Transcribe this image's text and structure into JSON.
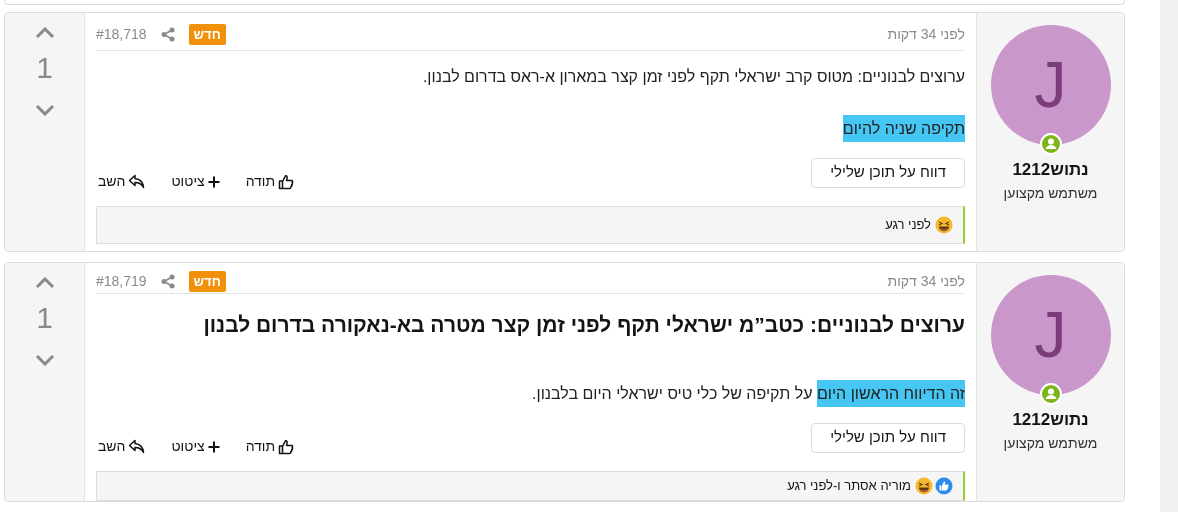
{
  "posts": [
    {
      "votes": "1",
      "time": "לפני 34 דקות",
      "badge": "חדש",
      "number": "#18,718",
      "author": {
        "name": "נתוש1212",
        "title": "משתמש מקצוען",
        "initial": "J",
        "online": true
      },
      "body": [
        {
          "kind": "text",
          "segments": [
            {
              "text": "ערוצים לבנוניים: מטוס קרב ישראלי תקף לפני זמן קצר במארון א-ראס בדרום לבנון.",
              "highlight": false
            }
          ]
        },
        {
          "kind": "text",
          "segments": [
            {
              "text": "תקיפה שניה להיום",
              "highlight": true
            }
          ]
        }
      ],
      "report": "דווח על תוכן שלילי",
      "actions": [
        {
          "kind": "thanks",
          "label": "תודה"
        },
        {
          "kind": "quote",
          "label": "ציטוט"
        },
        {
          "kind": "reply",
          "label": "השב"
        }
      ],
      "reactions": {
        "icons": [
          {
            "kind": "laugh"
          }
        ],
        "text": "לפני רגע"
      }
    },
    {
      "votes": "1",
      "time": "לפני 34 דקות",
      "badge": "חדש",
      "number": "#18,719",
      "author": {
        "name": "נתוש1212",
        "title": "משתמש מקצוען",
        "initial": "J",
        "online": true
      },
      "body": [
        {
          "kind": "title",
          "segments": [
            {
              "text": "ערוצים לבנוניים: כטב”מ ישראלי תקף לפני זמן קצר מטרה בא-נאקורה בדרום לבנון",
              "highlight": false
            }
          ]
        },
        {
          "kind": "text",
          "segments": [
            {
              "text": "זה הדיווח הראשון היום",
              "highlight": true
            },
            {
              "text": " על תקיפה של כלי טיס ישראלי היום בלבנון.",
              "highlight": false
            }
          ]
        }
      ],
      "report": "דווח על תוכן שלילי",
      "actions": [
        {
          "kind": "thanks",
          "label": "תודה"
        },
        {
          "kind": "quote",
          "label": "ציטוט"
        },
        {
          "kind": "reply",
          "label": "השב"
        }
      ],
      "reactions": {
        "icons": [
          {
            "kind": "like"
          },
          {
            "kind": "laugh"
          }
        ],
        "text": "מוריה אסתר ו-לפני רגע"
      }
    }
  ]
}
